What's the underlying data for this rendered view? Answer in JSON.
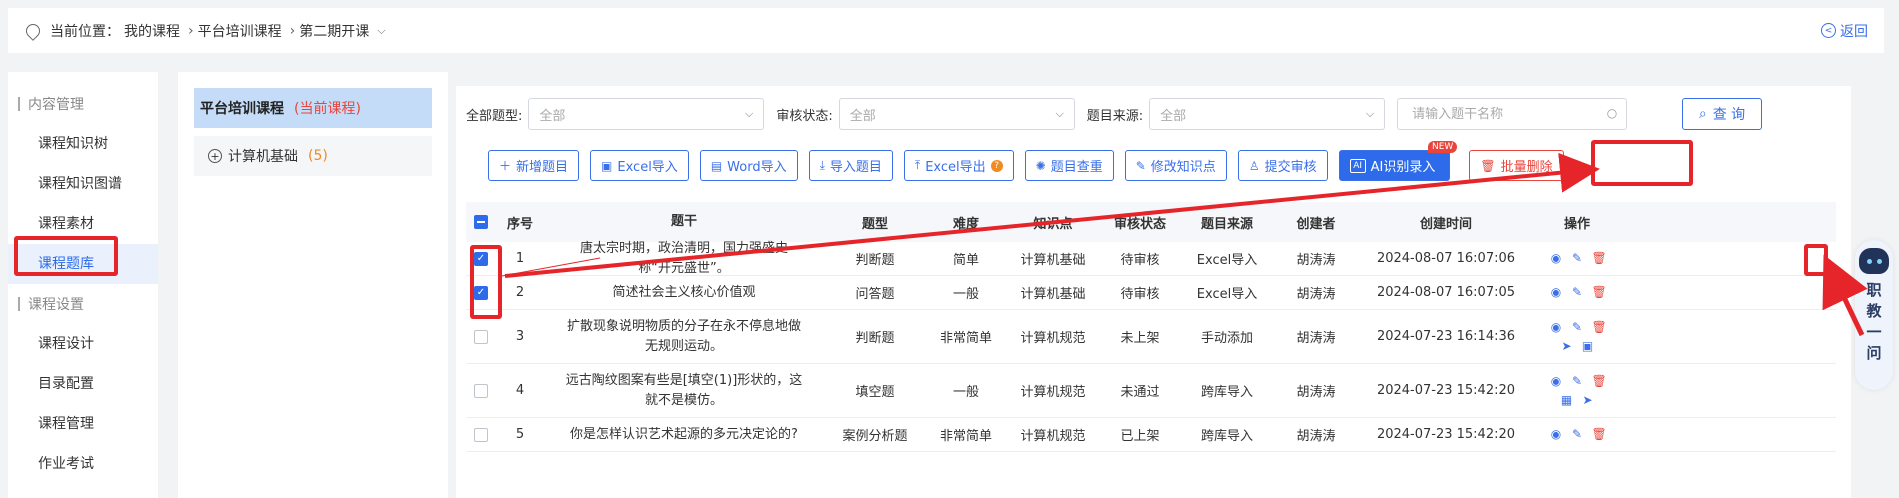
{
  "breadcrumb": {
    "prefix": "当前位置：",
    "items": [
      "我的课程",
      "平台培训课程",
      "第二期开课"
    ],
    "back_label": "返回"
  },
  "sidebar": {
    "groups": [
      {
        "title": "内容管理",
        "items": [
          "课程知识树",
          "课程知识图谱",
          "课程素材",
          "课程题库"
        ]
      },
      {
        "title": "课程设置",
        "items": [
          "课程设计",
          "目录配置",
          "课程管理",
          "作业考试"
        ]
      }
    ],
    "active": "课程题库"
  },
  "course_panel": {
    "title": "平台培训课程",
    "current_tag": "(当前课程)",
    "node_label": "计算机基础",
    "node_count": "(5)"
  },
  "filters": {
    "type_label": "全部题型:",
    "type_value": "全部",
    "audit_label": "审核状态:",
    "audit_value": "全部",
    "source_label": "题目来源:",
    "source_value": "全部",
    "search_placeholder": "请输入题干名称",
    "query_label": "查 询"
  },
  "toolbar": {
    "add": "新增题目",
    "excel_import": "Excel导入",
    "word_import": "Word导入",
    "import_questions": "导入题目",
    "excel_export": "Excel导出",
    "dedupe": "题目查重",
    "edit_kp": "修改知识点",
    "submit_audit": "提交审核",
    "ai_import": "AI识别录入",
    "ai_badge": "NEW",
    "batch_delete": "批量删除"
  },
  "table": {
    "headers": [
      "序号",
      "题干",
      "题型",
      "难度",
      "知识点",
      "审核状态",
      "题目来源",
      "创建者",
      "创建时间",
      "操作"
    ],
    "rows": [
      {
        "idx": "1",
        "stem": "唐太宗时期，政治清明，国力强盛史称“开元盛世”。",
        "type": "判断题",
        "diff": "简单",
        "kp": "计算机基础",
        "audit": "待审核",
        "src": "Excel导入",
        "creator": "胡涛涛",
        "time": "2024-08-07 16:07:06",
        "checked": true
      },
      {
        "idx": "2",
        "stem": "简述社会主义核心价值观",
        "type": "问答题",
        "diff": "一般",
        "kp": "计算机基础",
        "audit": "待审核",
        "src": "Excel导入",
        "creator": "胡涛涛",
        "time": "2024-08-07 16:07:05",
        "checked": true
      },
      {
        "idx": "3",
        "stem": "扩散现象说明物质的分子在永不停息地做无规则运动。",
        "type": "判断题",
        "diff": "非常简单",
        "kp": "计算机规范",
        "audit": "未上架",
        "src": "手动添加",
        "creator": "胡涛涛",
        "time": "2024-07-23 16:14:36",
        "checked": false
      },
      {
        "idx": "4",
        "stem": "远古陶纹图案有些是[填空(1)]形状的，这就不是模仿。",
        "type": "填空题",
        "diff": "一般",
        "kp": "计算机规范",
        "audit": "未通过",
        "src": "跨库导入",
        "creator": "胡涛涛",
        "time": "2024-07-23 15:42:20",
        "checked": false
      },
      {
        "idx": "5",
        "stem": "你是怎样认识艺术起源的多元决定论的?",
        "type": "案例分析题",
        "diff": "非常简单",
        "kp": "计算机规范",
        "audit": "已上架",
        "src": "跨库导入",
        "creator": "胡涛涛",
        "time": "2024-07-23 15:42:20",
        "checked": false
      }
    ]
  },
  "assistant": {
    "label": "职教一问"
  },
  "colors": {
    "accent": "#2d6bea",
    "danger": "#e8453c",
    "annotation": "#e5252a"
  }
}
